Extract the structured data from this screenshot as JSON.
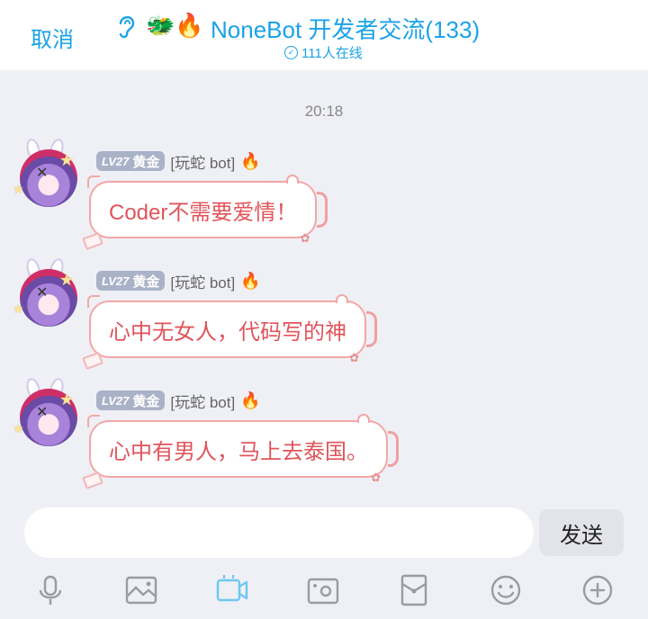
{
  "header": {
    "cancel_label": "取消",
    "title_emoji": "🐲🔥",
    "title": "NoneBot 开发者交流(133)",
    "online_check": "✓",
    "online_text": "111人在线"
  },
  "timestamp": "20:18",
  "messages": [
    {
      "level_prefix": "LV27",
      "level_title": "黄金",
      "sender": "[玩蛇 bot]",
      "flame": "🔥",
      "text": "Coder不需要爱情！"
    },
    {
      "level_prefix": "LV27",
      "level_title": "黄金",
      "sender": "[玩蛇 bot]",
      "flame": "🔥",
      "text": "心中无女人，代码写的神"
    },
    {
      "level_prefix": "LV27",
      "level_title": "黄金",
      "sender": "[玩蛇 bot]",
      "flame": "🔥",
      "text": "心中有男人，马上去泰国。"
    }
  ],
  "composer": {
    "input_value": "",
    "send_label": "发送"
  },
  "toolbar_icons": [
    "microphone-icon",
    "image-icon",
    "video-icon",
    "camera-icon",
    "red-packet-icon",
    "emoji-icon",
    "plus-icon"
  ],
  "colors": {
    "accent": "#1aa2e8",
    "bubble_text": "#e0545b",
    "bubble_border": "#f2a7a7",
    "icon_gray": "#9a9ba3"
  }
}
